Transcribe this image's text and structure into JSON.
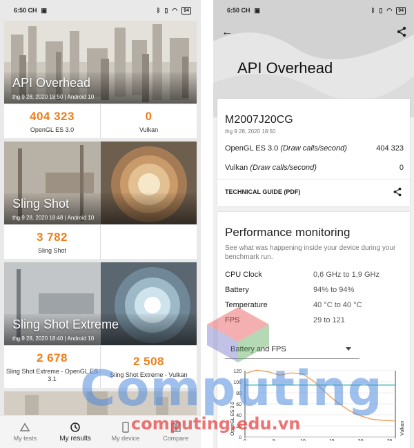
{
  "left": {
    "status": {
      "time": "6:50 CH",
      "battery": "94"
    },
    "cards": [
      {
        "title": "API Overhead",
        "meta": "thg 9 28, 2020 18:50 | Android 10",
        "scores": [
          {
            "value": "404 323",
            "label": "OpenGL ES 3.0"
          },
          {
            "value": "0",
            "label": "Vulkan"
          }
        ]
      },
      {
        "title": "Sling Shot",
        "meta": "thg 9 28, 2020 18:48 | Android 10",
        "scores": [
          {
            "value": "3 782",
            "label": "Sling Shot"
          }
        ]
      },
      {
        "title": "Sling Shot Extreme",
        "meta": "thg 9 28, 2020 18:40 | Android 10",
        "scores": [
          {
            "value": "2 678",
            "label": "Sling Shot Extreme - OpenGL ES 3.1"
          },
          {
            "value": "2 508",
            "label": "Sling Shot Extreme - Vulkan"
          }
        ]
      }
    ],
    "nav": [
      {
        "label": "My tests",
        "icon": "tests-icon"
      },
      {
        "label": "My results",
        "icon": "history-icon",
        "active": true
      },
      {
        "label": "My device",
        "icon": "phone-icon"
      },
      {
        "label": "Compare",
        "icon": "compare-icon"
      }
    ]
  },
  "right": {
    "status": {
      "time": "6:50 CH",
      "battery": "94"
    },
    "title": "API Overhead",
    "device": "M2007J20CG",
    "date": "thg 9 28, 2020 18:50",
    "results": [
      {
        "name": "OpenGL ES 3.0",
        "unit": "(Draw calls/second)",
        "value": "404 323"
      },
      {
        "name": "Vulkan",
        "unit": "(Draw calls/second)",
        "value": "0"
      }
    ],
    "guide": "TECHNICAL GUIDE (PDF)",
    "perf": {
      "title": "Performance monitoring",
      "desc": "See what was happening inside your device during your benchmark run.",
      "metrics": [
        {
          "label": "CPU Clock",
          "value": "0,6 GHz to 1,9 GHz"
        },
        {
          "label": "Battery",
          "value": "94% to 94%"
        },
        {
          "label": "Temperature",
          "value": "40 °C to 40 °C"
        },
        {
          "label": "FPS",
          "value": "29 to 121"
        }
      ],
      "dropdown": "Battery and FPS"
    },
    "chart_data": {
      "type": "line",
      "ylabel_left": "OpenGL ES 3.0",
      "ylabel_right": "Vulkan",
      "y_ticks": [
        120,
        100,
        80,
        60,
        40,
        20,
        0
      ],
      "x_ticks": [
        0,
        5,
        10,
        15,
        20,
        25
      ],
      "ylim": [
        0,
        120
      ],
      "xlim": [
        0,
        26
      ],
      "series": [
        {
          "color": "#3fb7b3",
          "x": [
            0,
            26
          ],
          "values": [
            94,
            94
          ]
        },
        {
          "color": "#f0a05a",
          "x": [
            0,
            2,
            4,
            6,
            8,
            10,
            12,
            14,
            16,
            18,
            20,
            22,
            24,
            26
          ],
          "values": [
            115,
            121,
            118,
            112,
            116,
            114,
            100,
            80,
            62,
            48,
            38,
            32,
            30,
            29
          ]
        }
      ]
    }
  },
  "watermark": {
    "text": "Computing",
    "url": "computing.edu.vn"
  }
}
